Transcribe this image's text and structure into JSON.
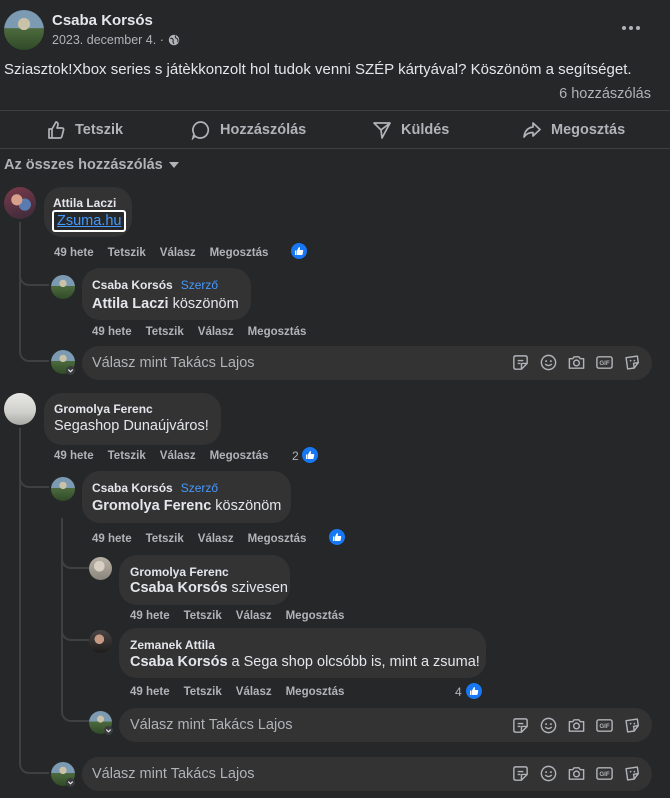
{
  "post": {
    "author": "Csaba Korsós",
    "date": "2023. december 4. ·",
    "text": "Sziasztok!Xbox series s játèkkonzolt hol tudok venni SZÉP kártyával? Köszönöm a segítséget.",
    "comment_count": "6 hozzászólás"
  },
  "actions": {
    "like": "Tetszik",
    "comment": "Hozzászólás",
    "send": "Küldés",
    "share": "Megosztás"
  },
  "filter": "Az összes hozzászólás",
  "meta_labels": {
    "time": "49 hete",
    "like": "Tetszik",
    "reply": "Válasz",
    "share": "Megosztás"
  },
  "author_tag": "Szerző",
  "reply_placeholder": "Válasz mint Takács Lajos",
  "comments": [
    {
      "name": "Attila Laczi",
      "text": "Zsuma.hu",
      "reactions": "",
      "replies": [
        {
          "name": "Csaba Korsós",
          "mention": "Attila Laczi",
          "text": " köszönöm",
          "reactions": ""
        }
      ]
    },
    {
      "name": "Gromolya Ferenc",
      "text": "Segashop Dunaújváros!",
      "reactions": "2",
      "replies": [
        {
          "name": "Csaba Korsós",
          "mention": "Gromolya Ferenc",
          "text": " köszönöm",
          "reactions": ""
        },
        {
          "name": "Gromolya Ferenc",
          "mention": "Csaba Korsós",
          "text": " szivesen",
          "reactions": ""
        },
        {
          "name": "Zemanek Attila",
          "mention": "Csaba Korsós",
          "text": " a Sega shop olcsóbb is, mint a zsuma!",
          "reactions": "4"
        }
      ]
    }
  ],
  "icons": [
    "more-options-icon",
    "globe-icon",
    "like-icon",
    "comment-icon",
    "send-icon",
    "share-icon",
    "chevron-down-icon",
    "sticker-icon",
    "emoji-icon",
    "camera-icon",
    "gif-icon",
    "avatar-sticker-icon"
  ],
  "colors": {
    "background": "#252728",
    "bubble": "#333334",
    "accent": "#1877f2",
    "author_tag": "#4599ff",
    "muted": "#b0b3b8"
  }
}
